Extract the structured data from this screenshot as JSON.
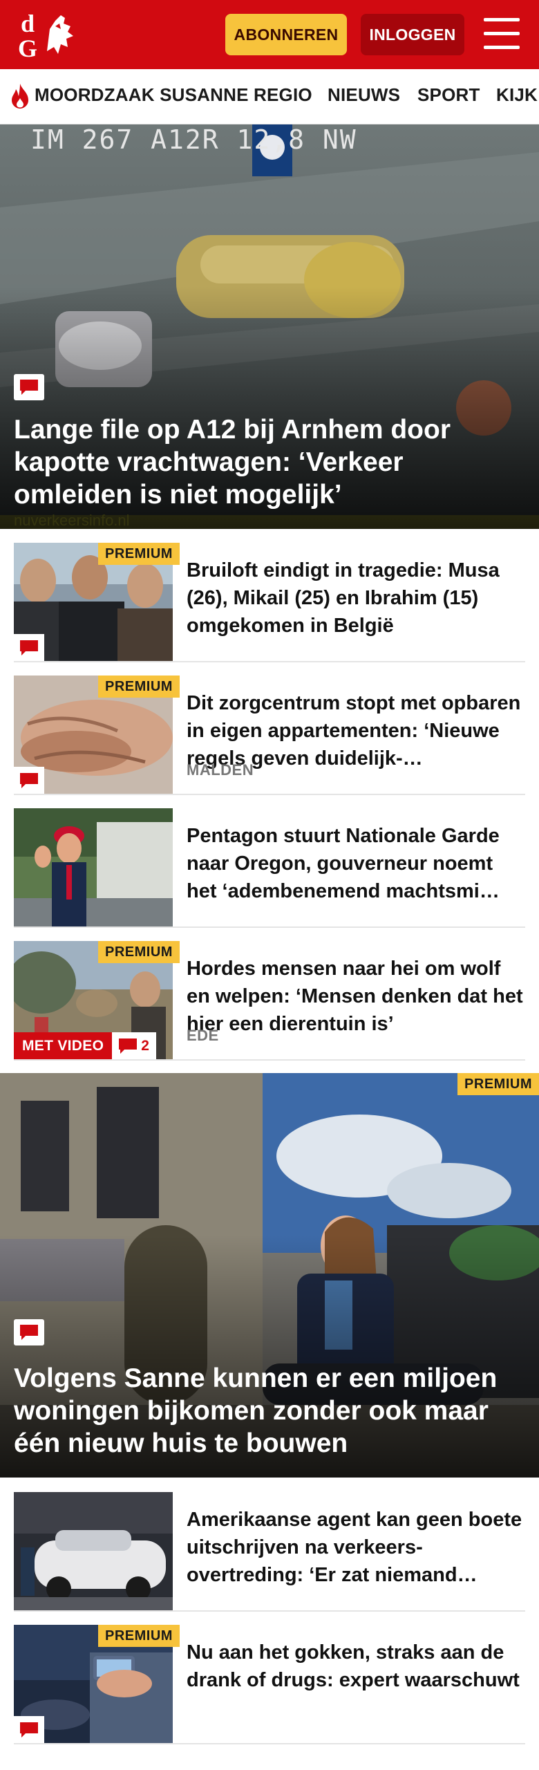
{
  "header": {
    "subscribe_label": "ABONNEREN",
    "login_label": "INLOGGEN",
    "logo_text": "dG",
    "brand_color": "#d10a11"
  },
  "nav": {
    "items": [
      "MOORDZAAK SUSANNE",
      "REGIO",
      "NIEUWS",
      "SPORT",
      "KIJK"
    ]
  },
  "hero1": {
    "title": "Lange file op A12 bij Arnhem door kapotte vrachtwagen: ‘Verkeer omleiden is niet mogelijk’",
    "overlay_top": "IM 267 A12R 12,8 NW",
    "watermark": "nuverkeersinfo.nl"
  },
  "articles": [
    {
      "headline": "Bruiloft eindigt in tragedie: Musa (26), Mikail (25) en Ibrahim (15) omgekomen in België",
      "premium": "PREMIUM",
      "place": ""
    },
    {
      "headline": "Dit zorgcentrum stopt met opbaren in eigen appartementen: ‘Nieuwe regels geven duidelijk-…",
      "premium": "PREMIUM",
      "place": "MALDEN"
    },
    {
      "headline": "Pentagon stuurt Nationale Garde naar Oregon, gouverneur noemt het ‘adembenemend machtsmi…",
      "premium": "",
      "place": ""
    },
    {
      "headline": "Hordes mensen naar hei om wolf en welpen: ‘Mensen denken dat het hier een dierentuin is’",
      "premium": "PREMIUM",
      "place": "EDE",
      "video_label": "MET VIDEO",
      "comment_count": "2"
    }
  ],
  "hero2": {
    "title": "Volgens Sanne kunnen er een miljoen woningen bijkomen zonder ook maar één nieuw huis te bouwen",
    "premium": "PREMIUM"
  },
  "articles2": [
    {
      "headline": "Amerikaanse agent kan geen boete uitschrijven na verkeers-overtreding: ‘Er zat niemand…",
      "premium": ""
    },
    {
      "headline": "Nu aan het gokken, straks aan de drank of drugs: expert waarschuwt",
      "premium": "PREMIUM"
    }
  ]
}
